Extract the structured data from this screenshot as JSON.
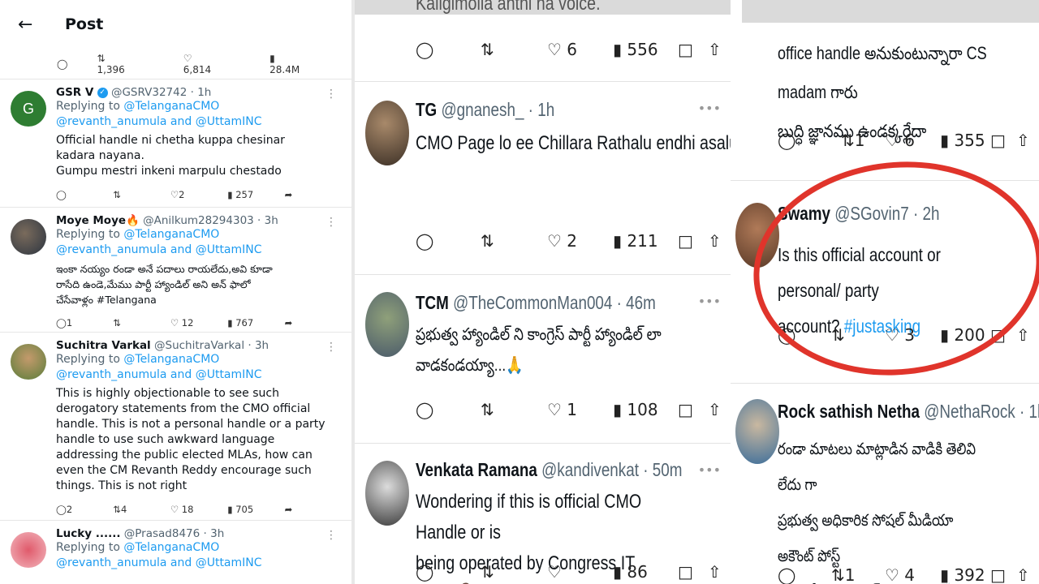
{
  "header": {
    "title": "Post"
  },
  "top_actions": {
    "replies": "",
    "reposts": "1,396",
    "likes": "6,814",
    "views": "28.4M"
  },
  "panel1": [
    {
      "name": "GSR V",
      "handle": "@GSRV32742",
      "time": "1h",
      "avatar_letter": "G",
      "replying": "Replying to",
      "to1": "@TelanganaCMO",
      "to2": "@revanth_anumula and @UttamINC",
      "text": "Official handle ni chetha kuppa chesinar\nkadara nayana.\nGumpu mestri inkeni marpulu chestado",
      "replies": "",
      "reposts": "",
      "likes": "2",
      "views": "257"
    },
    {
      "name": "Moye Moye🔥",
      "handle": "@Anilkum28294303",
      "time": "3h",
      "replying": "Replying to",
      "to1": "@TelanganaCMO",
      "to2": "@revanth_anumula and @UttamINC",
      "text": "ఇంకా నయ్యం రండా అనే పదాలు రాయలేదు,అవి కూడా\nరాసేది ఉండె,మేము పార్టీ హ్యాండిల్ అని అన్ ఫాలో\nచేసేవాళ్లం #Telangana",
      "replies": "1",
      "reposts": "",
      "likes": "12",
      "views": "767"
    },
    {
      "name": "Suchitra Varkal",
      "handle": "@SuchitraVarkal",
      "time": "3h",
      "replying": "Replying to",
      "to1": "@TelanganaCMO",
      "to2": "@revanth_anumula and @UttamINC",
      "text": "This is highly objectionable to see such\nderogatory statements from the CMO official\nhandle. This is not a personal handle or a party\nhandle to use such awkward language\naddressing the public elected MLAs, how can\neven the CM Revanth Reddy encourage such\nthings. This is not right",
      "replies": "2",
      "reposts": "4",
      "likes": "18",
      "views": "705"
    },
    {
      "name": "Lucky ......",
      "handle": "@Prasad8476",
      "time": "3h",
      "replying": "Replying to",
      "to1": "@TelanganaCMO",
      "to2": "@revanth_anumula and @UttamINC"
    }
  ],
  "panel2": [
    {
      "top_partial": "Kaligimolla anthi na voice.",
      "replies": "",
      "reposts": "",
      "likes": "6",
      "views": "556"
    },
    {
      "name": "TG",
      "handle": "@gnanesh_",
      "time": "1h",
      "text": "CMO Page lo ee Chillara Rathalu endhi asalu...",
      "replies": "",
      "reposts": "",
      "likes": "2",
      "views": "211"
    },
    {
      "name": "TCM",
      "handle": "@TheCommonMan004",
      "time": "46m",
      "text": "ప్రభుత్వ హ్యాండిల్ ని కాంగ్రెస్ పార్టీ హ్యాండిల్ లా\nవాడకండయ్యా...🙏",
      "replies": "",
      "reposts": "",
      "likes": "1",
      "views": "108"
    },
    {
      "name": "Venkata Ramana",
      "handle": "@kandivenkat",
      "time": "50m",
      "text": "Wondering if this is official CMO Handle or is\nbeing operated by Congress IT Cell? 🤷‍♂️",
      "replies": "",
      "reposts": "",
      "likes": "",
      "views": "86"
    }
  ],
  "panel3": [
    {
      "text": "office handle అనుకుంటున్నారా CS madam గారు\nబుద్ధి జ్ఞానము ఉండక్కర్లేదా",
      "replies": "",
      "reposts": "1",
      "likes": "6",
      "views": "355"
    },
    {
      "name": "Swamy",
      "handle": "@SGovin7",
      "time": "2h",
      "text": "Is this official account or personal/ party\naccount?",
      "hashtag": "#justasking",
      "replies": "",
      "reposts": "",
      "likes": "3",
      "views": "200"
    },
    {
      "name": "Rock sathish Netha",
      "handle": "@NethaRock",
      "time": "1h",
      "text": "రండా మాటలు మాట్లాడిన వాడికి తెలివి లేదు గా\nప్రభుత్వ అధికారిక సోషల్ మీడియా అకౌంట్ పోస్ట్\nపెట్టిన మీ తెలివి ఎమ్ అయింది 👏",
      "replies": "",
      "reposts": "1",
      "likes": "4",
      "views": "392"
    }
  ]
}
